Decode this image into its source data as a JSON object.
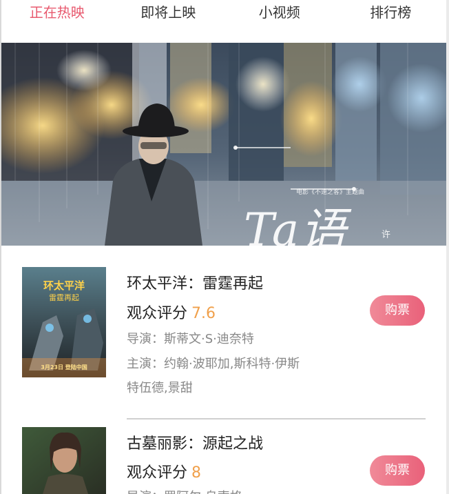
{
  "tabs": [
    {
      "label": "正在热映",
      "active": true
    },
    {
      "label": "即将上映",
      "active": false
    },
    {
      "label": "小视频",
      "active": false
    },
    {
      "label": "排行榜",
      "active": false
    }
  ],
  "banner": {
    "subtitle": "电影《不速之客》主题曲",
    "title": "Ta语",
    "singer": "许嵩",
    "dot_count": 3
  },
  "movies": [
    {
      "title": "环太平洋：雷霆再起",
      "score_label": "观众评分",
      "score": "7.6",
      "director": "导演：斯蒂文·S·迪奈特",
      "cast_line1": "主演：约翰·波耶加,斯科特·伊斯",
      "cast_line2": "特伍德,景甜",
      "buy_label": "购票",
      "poster_caption": "环太平洋",
      "poster_sub": "雷霆再起",
      "poster_date": "3月23日 登陆中国"
    },
    {
      "title": "古墓丽影：源起之战",
      "score_label": "观众评分",
      "score": "8",
      "director": "导演：罗阿尔·乌索格",
      "buy_label": "购票"
    }
  ],
  "colors": {
    "accent": "#e85a6f",
    "score": "#f0a04b",
    "button": "#ec7287"
  }
}
